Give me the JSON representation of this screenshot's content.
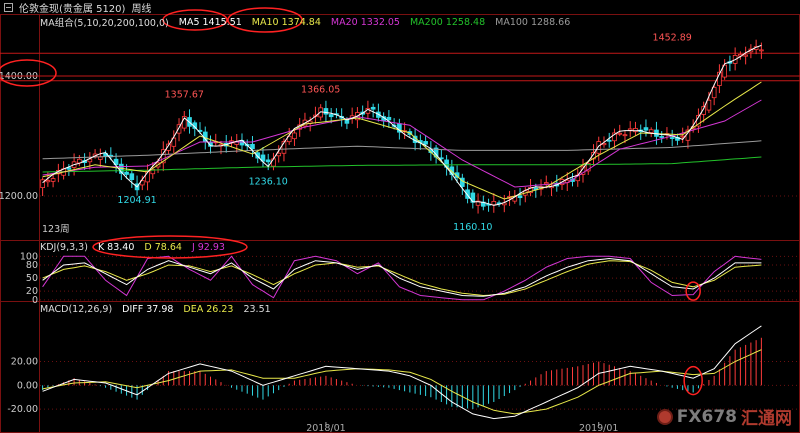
{
  "header": {
    "instrument": "伦敦金现(贵金属 5120)",
    "period": "周线"
  },
  "ma_legend": {
    "title": "MA组合(5,10,20,200,100,0)",
    "ma5": "MA5 1415.51",
    "ma10": "MA10 1374.84",
    "ma20": "MA20 1332.05",
    "ma200": "MA200 1258.48",
    "ma100": "MA100 1288.66"
  },
  "kdj_legend": {
    "title": "KDJ(9,3,3)",
    "k": "K 83.40",
    "d": "D 78.64",
    "j": "J 92.93"
  },
  "macd_legend": {
    "title": "MACD(12,26,9)",
    "diff": "DIFF 37.98",
    "dea": "DEA 26.23",
    "macd": "23.51"
  },
  "watermark": {
    "text": "FX678",
    "cn": "汇通网"
  },
  "colors": {
    "up": "#ff3b3b",
    "down": "#31d9e6",
    "ma5": "#ffffff",
    "ma10": "#e8e84a",
    "ma20": "#d436d4",
    "ma200": "#22c22a",
    "ma100": "#9a9a9a",
    "kdj_k": "#ffffff",
    "kdj_d": "#e8e84a",
    "kdj_j": "#d436d4",
    "highlight": "#ff2222"
  },
  "chart_data": {
    "type": "candlestick",
    "price_axis": {
      "ylim": [
        1140,
        1480
      ],
      "ticks": [
        "1400.00",
        "1200.00"
      ],
      "tick_values": [
        1400,
        1200
      ]
    },
    "kdj_axis": {
      "ylim": [
        -5,
        110
      ],
      "ticks": [
        "100",
        "80",
        "50",
        "20",
        "0"
      ],
      "tick_values": [
        100,
        80,
        50,
        20,
        0
      ]
    },
    "macd_axis": {
      "ylim": [
        -30,
        60
      ],
      "ticks": [
        "20.00",
        "0.00",
        "-20.00"
      ],
      "tick_values": [
        20,
        0,
        -20
      ]
    },
    "time_labels": [
      "2018/01",
      "2019/01"
    ],
    "time_label_index": [
      54,
      106
    ],
    "bars_label": "123周",
    "annotations": [
      {
        "text": "1357.67",
        "index": 27,
        "value": 1357.67,
        "pos": "above"
      },
      {
        "text": "1366.05",
        "index": 53,
        "value": 1366.05,
        "pos": "above"
      },
      {
        "text": "1236.10",
        "index": 43,
        "value": 1236.1,
        "pos": "below"
      },
      {
        "text": "1204.91",
        "index": 18,
        "value": 1204.91,
        "pos": "below"
      },
      {
        "text": "1160.10",
        "index": 82,
        "value": 1160.1,
        "pos": "below"
      },
      {
        "text": "1452.89",
        "index": 120,
        "value": 1452.89,
        "pos": "above"
      }
    ],
    "horizontal_lines": [
      1438,
      1400,
      1392
    ],
    "close_path": [
      [
        0,
        1222
      ],
      [
        6,
        1255
      ],
      [
        12,
        1270
      ],
      [
        18,
        1215
      ],
      [
        22,
        1258
      ],
      [
        27,
        1330
      ],
      [
        32,
        1285
      ],
      [
        38,
        1290
      ],
      [
        43,
        1252
      ],
      [
        48,
        1310
      ],
      [
        53,
        1342
      ],
      [
        58,
        1326
      ],
      [
        62,
        1346
      ],
      [
        66,
        1322
      ],
      [
        70,
        1300
      ],
      [
        74,
        1276
      ],
      [
        78,
        1240
      ],
      [
        82,
        1188
      ],
      [
        86,
        1186
      ],
      [
        90,
        1198
      ],
      [
        94,
        1215
      ],
      [
        98,
        1220
      ],
      [
        102,
        1232
      ],
      [
        106,
        1286
      ],
      [
        110,
        1305
      ],
      [
        114,
        1312
      ],
      [
        118,
        1300
      ],
      [
        122,
        1296
      ],
      [
        126,
        1345
      ],
      [
        130,
        1420
      ],
      [
        134,
        1440
      ],
      [
        137,
        1448
      ]
    ],
    "ma_series": {
      "ma10_path": [
        [
          0,
          1232
        ],
        [
          10,
          1252
        ],
        [
          20,
          1240
        ],
        [
          30,
          1300
        ],
        [
          40,
          1270
        ],
        [
          50,
          1320
        ],
        [
          60,
          1330
        ],
        [
          70,
          1305
        ],
        [
          80,
          1225
        ],
        [
          88,
          1195
        ],
        [
          96,
          1215
        ],
        [
          106,
          1268
        ],
        [
          114,
          1305
        ],
        [
          122,
          1302
        ],
        [
          130,
          1350
        ],
        [
          137,
          1390
        ]
      ],
      "ma20_path": [
        [
          0,
          1235
        ],
        [
          10,
          1248
        ],
        [
          20,
          1250
        ],
        [
          30,
          1290
        ],
        [
          40,
          1290
        ],
        [
          50,
          1315
        ],
        [
          60,
          1332
        ],
        [
          70,
          1318
        ],
        [
          80,
          1260
        ],
        [
          90,
          1215
        ],
        [
          100,
          1222
        ],
        [
          110,
          1278
        ],
        [
          120,
          1300
        ],
        [
          130,
          1325
        ],
        [
          137,
          1360
        ]
      ],
      "ma200_path": [
        [
          0,
          1240
        ],
        [
          20,
          1243
        ],
        [
          40,
          1248
        ],
        [
          60,
          1251
        ],
        [
          80,
          1252
        ],
        [
          100,
          1252
        ],
        [
          120,
          1254
        ],
        [
          137,
          1265
        ]
      ],
      "ma100_path": [
        [
          0,
          1262
        ],
        [
          20,
          1268
        ],
        [
          40,
          1276
        ],
        [
          60,
          1283
        ],
        [
          80,
          1276
        ],
        [
          100,
          1276
        ],
        [
          120,
          1281
        ],
        [
          137,
          1292
        ]
      ]
    },
    "kdj": {
      "k_path": [
        [
          0,
          45
        ],
        [
          4,
          80
        ],
        [
          8,
          85
        ],
        [
          12,
          60
        ],
        [
          16,
          35
        ],
        [
          20,
          70
        ],
        [
          24,
          90
        ],
        [
          28,
          75
        ],
        [
          32,
          60
        ],
        [
          36,
          85
        ],
        [
          40,
          50
        ],
        [
          44,
          25
        ],
        [
          48,
          70
        ],
        [
          52,
          90
        ],
        [
          56,
          85
        ],
        [
          60,
          70
        ],
        [
          64,
          80
        ],
        [
          68,
          50
        ],
        [
          72,
          30
        ],
        [
          76,
          20
        ],
        [
          80,
          10
        ],
        [
          84,
          8
        ],
        [
          88,
          15
        ],
        [
          92,
          30
        ],
        [
          96,
          55
        ],
        [
          100,
          75
        ],
        [
          104,
          90
        ],
        [
          108,
          95
        ],
        [
          112,
          90
        ],
        [
          116,
          60
        ],
        [
          120,
          30
        ],
        [
          124,
          25
        ],
        [
          128,
          50
        ],
        [
          132,
          85
        ],
        [
          137,
          85
        ]
      ],
      "d_path": [
        [
          0,
          50
        ],
        [
          4,
          70
        ],
        [
          8,
          78
        ],
        [
          12,
          65
        ],
        [
          16,
          45
        ],
        [
          20,
          60
        ],
        [
          24,
          80
        ],
        [
          28,
          78
        ],
        [
          32,
          65
        ],
        [
          36,
          78
        ],
        [
          40,
          58
        ],
        [
          44,
          35
        ],
        [
          48,
          60
        ],
        [
          52,
          80
        ],
        [
          56,
          85
        ],
        [
          60,
          75
        ],
        [
          64,
          78
        ],
        [
          68,
          58
        ],
        [
          72,
          38
        ],
        [
          76,
          25
        ],
        [
          80,
          15
        ],
        [
          84,
          10
        ],
        [
          88,
          13
        ],
        [
          92,
          25
        ],
        [
          96,
          45
        ],
        [
          100,
          65
        ],
        [
          104,
          82
        ],
        [
          108,
          90
        ],
        [
          112,
          88
        ],
        [
          116,
          68
        ],
        [
          120,
          40
        ],
        [
          124,
          30
        ],
        [
          128,
          45
        ],
        [
          132,
          75
        ],
        [
          137,
          80
        ]
      ],
      "j_path": [
        [
          0,
          30
        ],
        [
          4,
          100
        ],
        [
          8,
          100
        ],
        [
          12,
          45
        ],
        [
          16,
          10
        ],
        [
          20,
          95
        ],
        [
          24,
          100
        ],
        [
          28,
          70
        ],
        [
          32,
          45
        ],
        [
          36,
          100
        ],
        [
          40,
          35
        ],
        [
          44,
          5
        ],
        [
          48,
          90
        ],
        [
          52,
          100
        ],
        [
          56,
          90
        ],
        [
          60,
          60
        ],
        [
          64,
          85
        ],
        [
          68,
          30
        ],
        [
          72,
          10
        ],
        [
          76,
          5
        ],
        [
          80,
          0
        ],
        [
          84,
          0
        ],
        [
          88,
          20
        ],
        [
          92,
          45
        ],
        [
          96,
          75
        ],
        [
          100,
          95
        ],
        [
          104,
          100
        ],
        [
          108,
          100
        ],
        [
          112,
          95
        ],
        [
          116,
          40
        ],
        [
          120,
          10
        ],
        [
          124,
          12
        ],
        [
          128,
          65
        ],
        [
          132,
          100
        ],
        [
          137,
          93
        ]
      ]
    },
    "macd": {
      "diff_path": [
        [
          0,
          -5
        ],
        [
          6,
          5
        ],
        [
          12,
          2
        ],
        [
          18,
          -8
        ],
        [
          24,
          10
        ],
        [
          30,
          18
        ],
        [
          36,
          12
        ],
        [
          42,
          0
        ],
        [
          48,
          8
        ],
        [
          54,
          16
        ],
        [
          60,
          14
        ],
        [
          66,
          12
        ],
        [
          70,
          8
        ],
        [
          74,
          0
        ],
        [
          78,
          -14
        ],
        [
          82,
          -24
        ],
        [
          86,
          -28
        ],
        [
          90,
          -26
        ],
        [
          96,
          -14
        ],
        [
          102,
          -2
        ],
        [
          106,
          10
        ],
        [
          112,
          16
        ],
        [
          118,
          12
        ],
        [
          124,
          6
        ],
        [
          128,
          14
        ],
        [
          132,
          35
        ],
        [
          137,
          50
        ]
      ],
      "dea_path": [
        [
          0,
          -3
        ],
        [
          6,
          2
        ],
        [
          12,
          3
        ],
        [
          18,
          -2
        ],
        [
          24,
          4
        ],
        [
          30,
          12
        ],
        [
          36,
          13
        ],
        [
          42,
          6
        ],
        [
          48,
          6
        ],
        [
          54,
          12
        ],
        [
          60,
          14
        ],
        [
          66,
          13
        ],
        [
          70,
          11
        ],
        [
          74,
          5
        ],
        [
          78,
          -5
        ],
        [
          82,
          -14
        ],
        [
          86,
          -21
        ],
        [
          90,
          -24
        ],
        [
          96,
          -20
        ],
        [
          102,
          -10
        ],
        [
          106,
          0
        ],
        [
          112,
          10
        ],
        [
          118,
          12
        ],
        [
          124,
          9
        ],
        [
          128,
          10
        ],
        [
          132,
          20
        ],
        [
          137,
          30
        ]
      ]
    }
  }
}
